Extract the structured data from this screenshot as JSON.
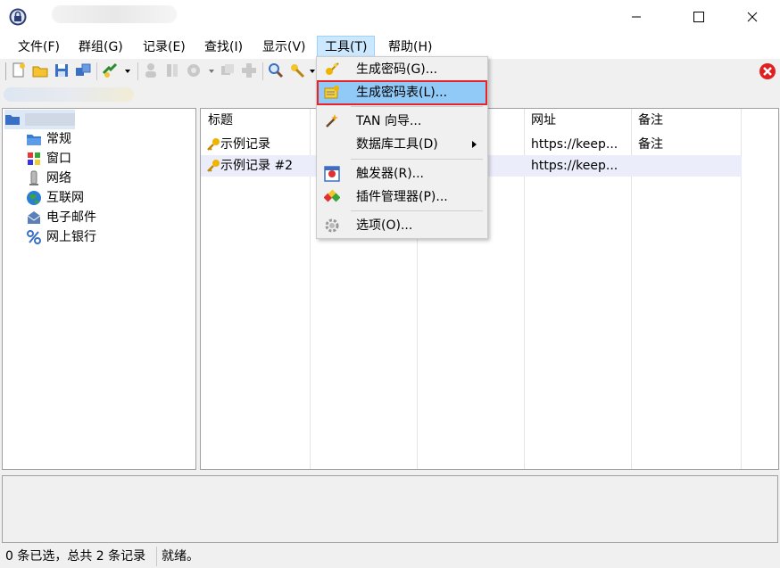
{
  "menubar": {
    "items": [
      {
        "id": "file",
        "label": "文件(F)"
      },
      {
        "id": "group",
        "label": "群组(G)"
      },
      {
        "id": "entry",
        "label": "记录(E)"
      },
      {
        "id": "find",
        "label": "查找(I)"
      },
      {
        "id": "view",
        "label": "显示(V)"
      },
      {
        "id": "tools",
        "label": "工具(T)"
      },
      {
        "id": "help",
        "label": "帮助(H)"
      }
    ]
  },
  "tree": {
    "groups": [
      {
        "label": "常规",
        "icon": "folder-icon"
      },
      {
        "label": "窗口",
        "icon": "windows-icon"
      },
      {
        "label": "网络",
        "icon": "network-icon"
      },
      {
        "label": "互联网",
        "icon": "globe-icon"
      },
      {
        "label": "电子邮件",
        "icon": "email-icon"
      },
      {
        "label": "网上银行",
        "icon": "percent-icon"
      }
    ]
  },
  "list": {
    "columns": [
      "标题",
      "网址",
      "备注"
    ],
    "rows": [
      {
        "title": "示例记录",
        "url": "https://keep...",
        "notes": "备注"
      },
      {
        "title": "示例记录 #2",
        "url": "https://keep...",
        "notes": ""
      }
    ]
  },
  "tools_menu": {
    "items": [
      {
        "label": "生成密码(G)...",
        "icon": "key-wand-icon"
      },
      {
        "label": "生成密码表(L)...",
        "icon": "password-list-icon",
        "highlighted": true
      },
      {
        "label": "TAN 向导...",
        "icon": "magic-wand-icon"
      },
      {
        "label": "数据库工具(D)",
        "icon": "",
        "submenu": true
      },
      {
        "label": "触发器(R)...",
        "icon": "trigger-icon"
      },
      {
        "label": "插件管理器(P)...",
        "icon": "plugin-icon"
      },
      {
        "label": "选项(O)...",
        "icon": "gear-icon"
      }
    ]
  },
  "status": {
    "selection": "0 条已选，总共 2 条记录",
    "state": "就绪。"
  },
  "colors": {
    "highlight": "#91c9f7",
    "highlight_border": "#e8242a",
    "menu_active": "#cce8ff"
  }
}
